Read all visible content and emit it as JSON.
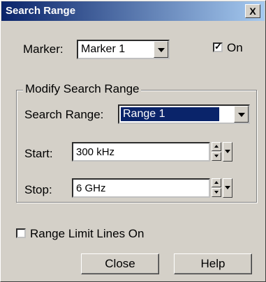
{
  "window": {
    "title": "Search Range",
    "close_symbol": "X"
  },
  "marker": {
    "label": "Marker:",
    "selected": "Marker 1"
  },
  "on_checkbox": {
    "label": "On",
    "checked": true
  },
  "group": {
    "legend": "Modify Search Range",
    "search_range": {
      "label": "Search Range:",
      "selected": "Range 1"
    },
    "start": {
      "label": "Start:",
      "value": "300 kHz"
    },
    "stop": {
      "label": "Stop:",
      "value": "6 GHz"
    }
  },
  "limit_lines_checkbox": {
    "label": "Range Limit Lines On",
    "checked": false
  },
  "buttons": {
    "close": "Close",
    "help": "Help"
  },
  "colors": {
    "title_bar": "#0a246a",
    "selection": "#0a246a",
    "face": "#d4d0c8"
  }
}
